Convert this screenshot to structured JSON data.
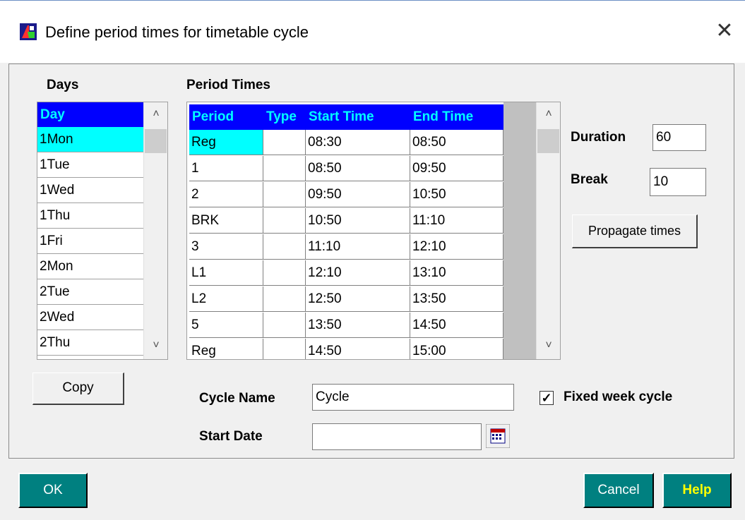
{
  "window": {
    "title": "Define period times for timetable cycle",
    "close_glyph": "✕"
  },
  "days": {
    "label": "Days",
    "header": "Day",
    "items": [
      "1Mon",
      "1Tue",
      "1Wed",
      "1Thu",
      "1Fri",
      "2Mon",
      "2Tue",
      "2Wed",
      "2Thu"
    ],
    "selected": "1Mon",
    "copy_button": "Copy"
  },
  "periods": {
    "label": "Period Times",
    "columns": [
      "Period",
      "Type",
      "Start Time",
      "End Time"
    ],
    "rows": [
      [
        "Reg",
        "",
        "08:30",
        "08:50"
      ],
      [
        "1",
        "",
        "08:50",
        "09:50"
      ],
      [
        "2",
        "",
        "09:50",
        "10:50"
      ],
      [
        "BRK",
        "",
        "10:50",
        "11:10"
      ],
      [
        "3",
        "",
        "11:10",
        "12:10"
      ],
      [
        "L1",
        "",
        "12:10",
        "13:10"
      ],
      [
        "L2",
        "",
        "12:50",
        "13:50"
      ],
      [
        "5",
        "",
        "13:50",
        "14:50"
      ],
      [
        "Reg",
        "",
        "14:50",
        "15:00"
      ]
    ]
  },
  "side": {
    "duration_label": "Duration",
    "duration_value": "60",
    "break_label": "Break",
    "break_value": "10",
    "propagate_button": "Propagate times"
  },
  "cycle": {
    "name_label": "Cycle Name",
    "name_value": "Cycle",
    "start_date_label": "Start Date",
    "start_date_value": "",
    "fixed_week_label": "Fixed week cycle",
    "fixed_week_checked": true
  },
  "buttons": {
    "ok": "OK",
    "cancel": "Cancel",
    "help": "Help"
  },
  "colors": {
    "header_bg": "#0000ff",
    "header_text": "#00ffff",
    "selection": "#00ffff",
    "button_teal": "#008080",
    "ok_text": "#ffffff",
    "cancel_text": "#ffffff",
    "help_text": "#ffff00"
  },
  "icons": {
    "app": "app-icon",
    "close": "close-icon",
    "calendar": "calendar-icon",
    "scroll_up": "chevron-up-icon",
    "scroll_down": "chevron-down-icon"
  }
}
